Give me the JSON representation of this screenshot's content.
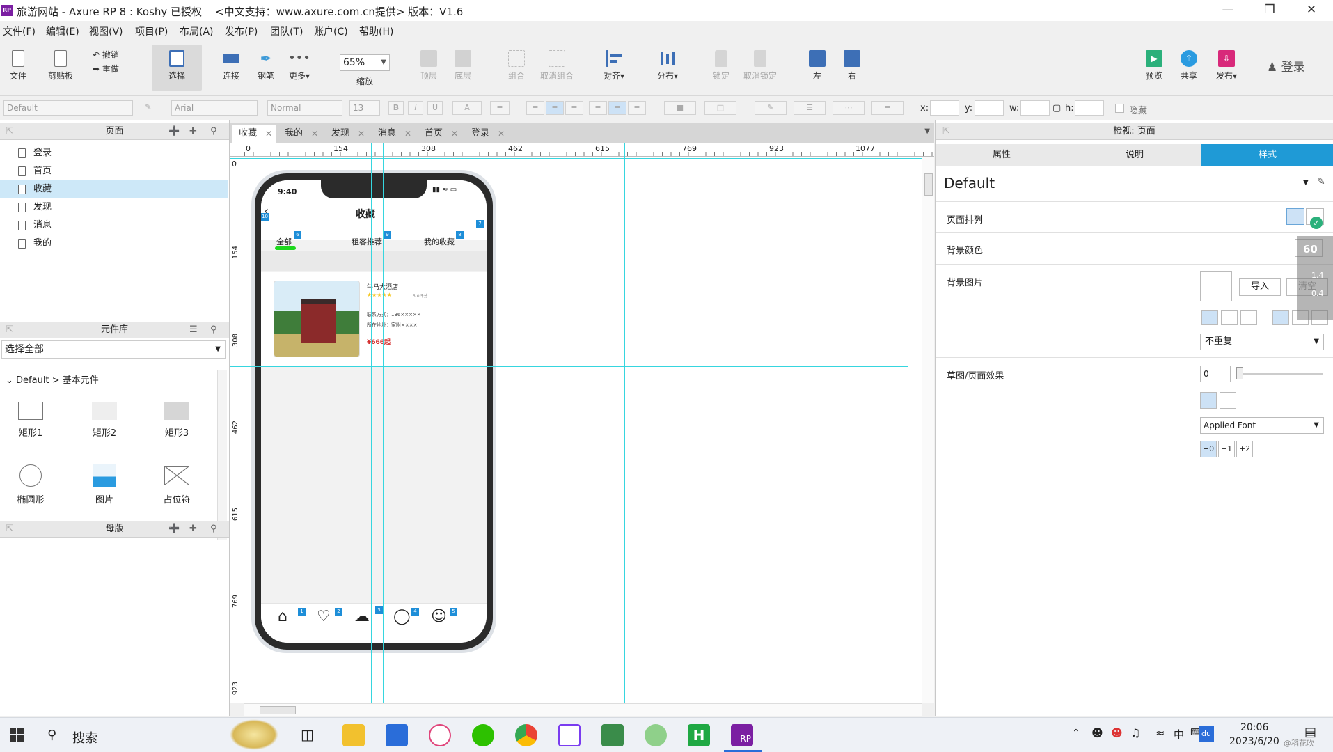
{
  "window": {
    "title": "旅游网站 - Axure RP 8 : Koshy 已授权    <中文支持：www.axure.com.cn提供> 版本：V1.6",
    "app_icon": "RP"
  },
  "menu": [
    "文件(F)",
    "编辑(E)",
    "视图(V)",
    "项目(P)",
    "布局(A)",
    "发布(P)",
    "团队(T)",
    "账户(C)",
    "帮助(H)"
  ],
  "toolbar": {
    "file": "文件",
    "clipboard": "剪贴板",
    "undo": "撤销",
    "redo": "重做",
    "select": "选择",
    "connect": "连接",
    "pen": "钢笔",
    "more": "更多▾",
    "zoom_value": "65%",
    "zoom_label": "缩放",
    "top_layer": "顶层",
    "bottom_layer": "底层",
    "group": "组合",
    "ungroup": "取消组合",
    "align": "对齐▾",
    "distribute": "分布▾",
    "lock": "锁定",
    "unlock": "取消锁定",
    "left": "左",
    "right": "右",
    "preview": "预览",
    "share": "共享",
    "publish": "发布▾",
    "login": "登录"
  },
  "format": {
    "style": "Default",
    "font": "Arial",
    "weight": "Normal",
    "size": "13",
    "x_label": "x:",
    "y_label": "y:",
    "w_label": "w:",
    "h_label": "h:",
    "hidden_label": "隐藏"
  },
  "pages_panel": {
    "title": "页面",
    "items": [
      "登录",
      "首页",
      "收藏",
      "发现",
      "消息",
      "我的"
    ],
    "selected": "收藏"
  },
  "library_panel": {
    "title": "元件库",
    "dropdown": "选择全部",
    "group": "Default > 基本元件",
    "widgets": [
      "矩形1",
      "矩形2",
      "矩形3",
      "椭圆形",
      "图片",
      "占位符"
    ]
  },
  "masters_panel": {
    "title": "母版"
  },
  "tabs": [
    "收藏",
    "我的",
    "发现",
    "消息",
    "首页",
    "登录"
  ],
  "rulers": {
    "h": [
      "0",
      "154",
      "308",
      "462",
      "615",
      "769",
      "923",
      "1077"
    ],
    "v": [
      "0",
      "154",
      "308",
      "462",
      "615",
      "769",
      "923"
    ]
  },
  "phone": {
    "time": "9:40",
    "title": "收藏",
    "tabs": [
      "全部",
      "租客推荐",
      "我的收藏"
    ],
    "hotel_name": "牛马大酒店",
    "rating": "★★★★★",
    "rating_text": "5.0评分",
    "contact": "联系方式：136×××××",
    "address": "所在地址：家附××××",
    "price": "¥666起",
    "badges": [
      "10",
      "6",
      "9",
      "8",
      "7",
      "1",
      "2",
      "3",
      "4",
      "5"
    ]
  },
  "inspector": {
    "title": "检视: 页面",
    "tabs": [
      "属性",
      "说明",
      "样式"
    ],
    "active_tab": "样式",
    "style_name": "Default",
    "page_align": "页面排列",
    "bg_color": "背景颜色",
    "bg_image": "背景图片",
    "import": "导入",
    "clear": "清空",
    "repeat": "不重复",
    "sketch": "草图/页面效果",
    "sketch_value": "0",
    "font": "Applied Font",
    "steps": [
      "+0",
      "+1",
      "+2"
    ],
    "net_speed": "60",
    "net_up": "1.4",
    "net_down": "0.4"
  },
  "taskbar": {
    "search": "搜索",
    "time": "20:06",
    "date": "2023/6/20",
    "ime": "中",
    "watermark": "@稻花吹"
  }
}
